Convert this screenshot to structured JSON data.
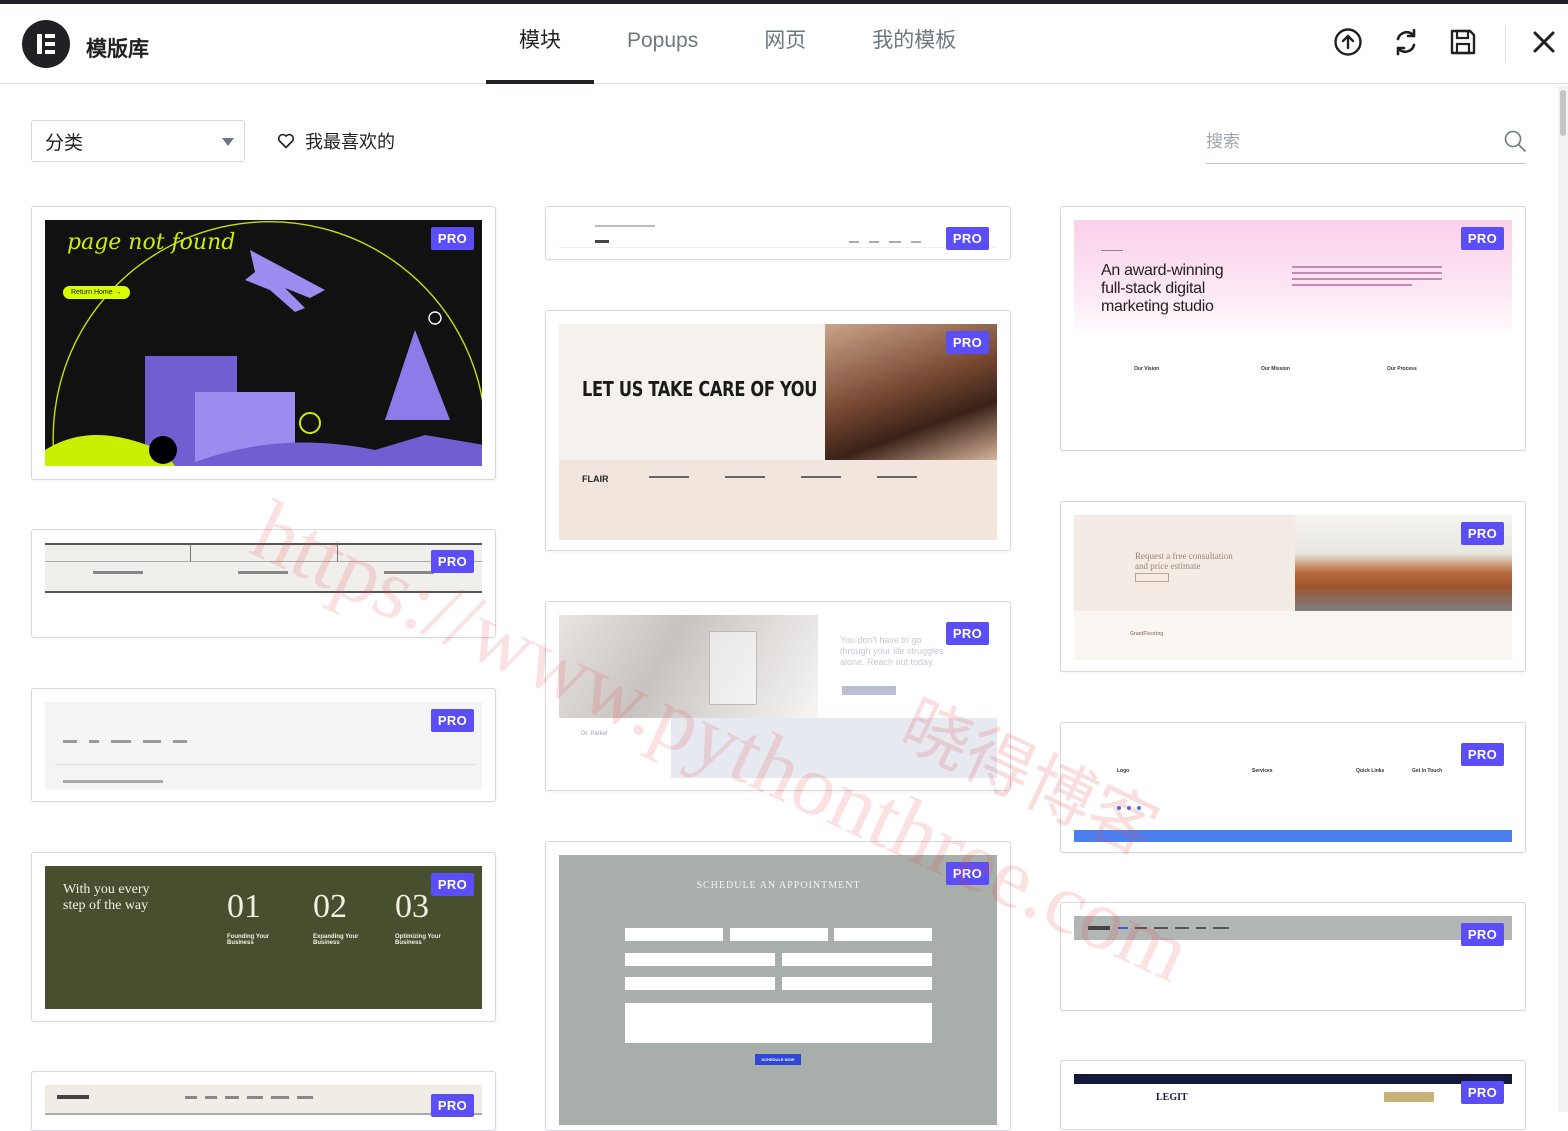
{
  "header": {
    "title": "模版库",
    "tabs": [
      {
        "label": "模块",
        "active": true
      },
      {
        "label": "Popups",
        "active": false
      },
      {
        "label": "网页",
        "active": false
      },
      {
        "label": "我的模板",
        "active": false
      }
    ],
    "icons": [
      "upload-icon",
      "sync-icon",
      "save-icon",
      "close-icon"
    ]
  },
  "toolbar": {
    "category_label": "分类",
    "favorites_label": "我最喜欢的",
    "search_placeholder": "搜索"
  },
  "badge_label": "PRO",
  "cards": {
    "c1": {
      "title": "page not found",
      "button": "Return Home →"
    },
    "c5": {
      "heading": "LET US TAKE CARE OF YOU",
      "brand": "FLAIR"
    },
    "c6": {
      "line1": "You don't have to go",
      "line2": "through your life struggles",
      "line3": "alone. Reach out today.",
      "name": "Dr. Parker"
    },
    "c7": {
      "heading": "SCHEDULE AN APPOINTMENT",
      "button": "SCHEDULE NOW"
    },
    "c8": {
      "line1": "An award-winning",
      "line2": "full-stack digital",
      "line3": "marketing studio",
      "col1": "Our Vision",
      "col2": "Our Mission",
      "col3": "Our Process"
    },
    "c9": {
      "line1": "Request a free consultation",
      "line2": "and price estimate",
      "brand": "GrantFlooring"
    },
    "c10": {
      "logo": "Logo",
      "col1": "Services",
      "col2": "Quick Links",
      "col3": "Get In Touch"
    },
    "c4": {
      "heading_line1": "With you every",
      "heading_line2": "step of the way",
      "num1": "01",
      "num2": "02",
      "num3": "03",
      "label1": "Founding Your Business",
      "label2": "Expanding Your Business",
      "label3": "Optimizing Your Business"
    },
    "c12": {
      "logo": "LEGIT"
    }
  },
  "watermark": {
    "line1": "https://www.pythonthree.com",
    "line2": "晓得博客"
  },
  "colors": {
    "accent": "#5b4ef7",
    "dark": "#1f2124",
    "muted": "#6d7882"
  }
}
